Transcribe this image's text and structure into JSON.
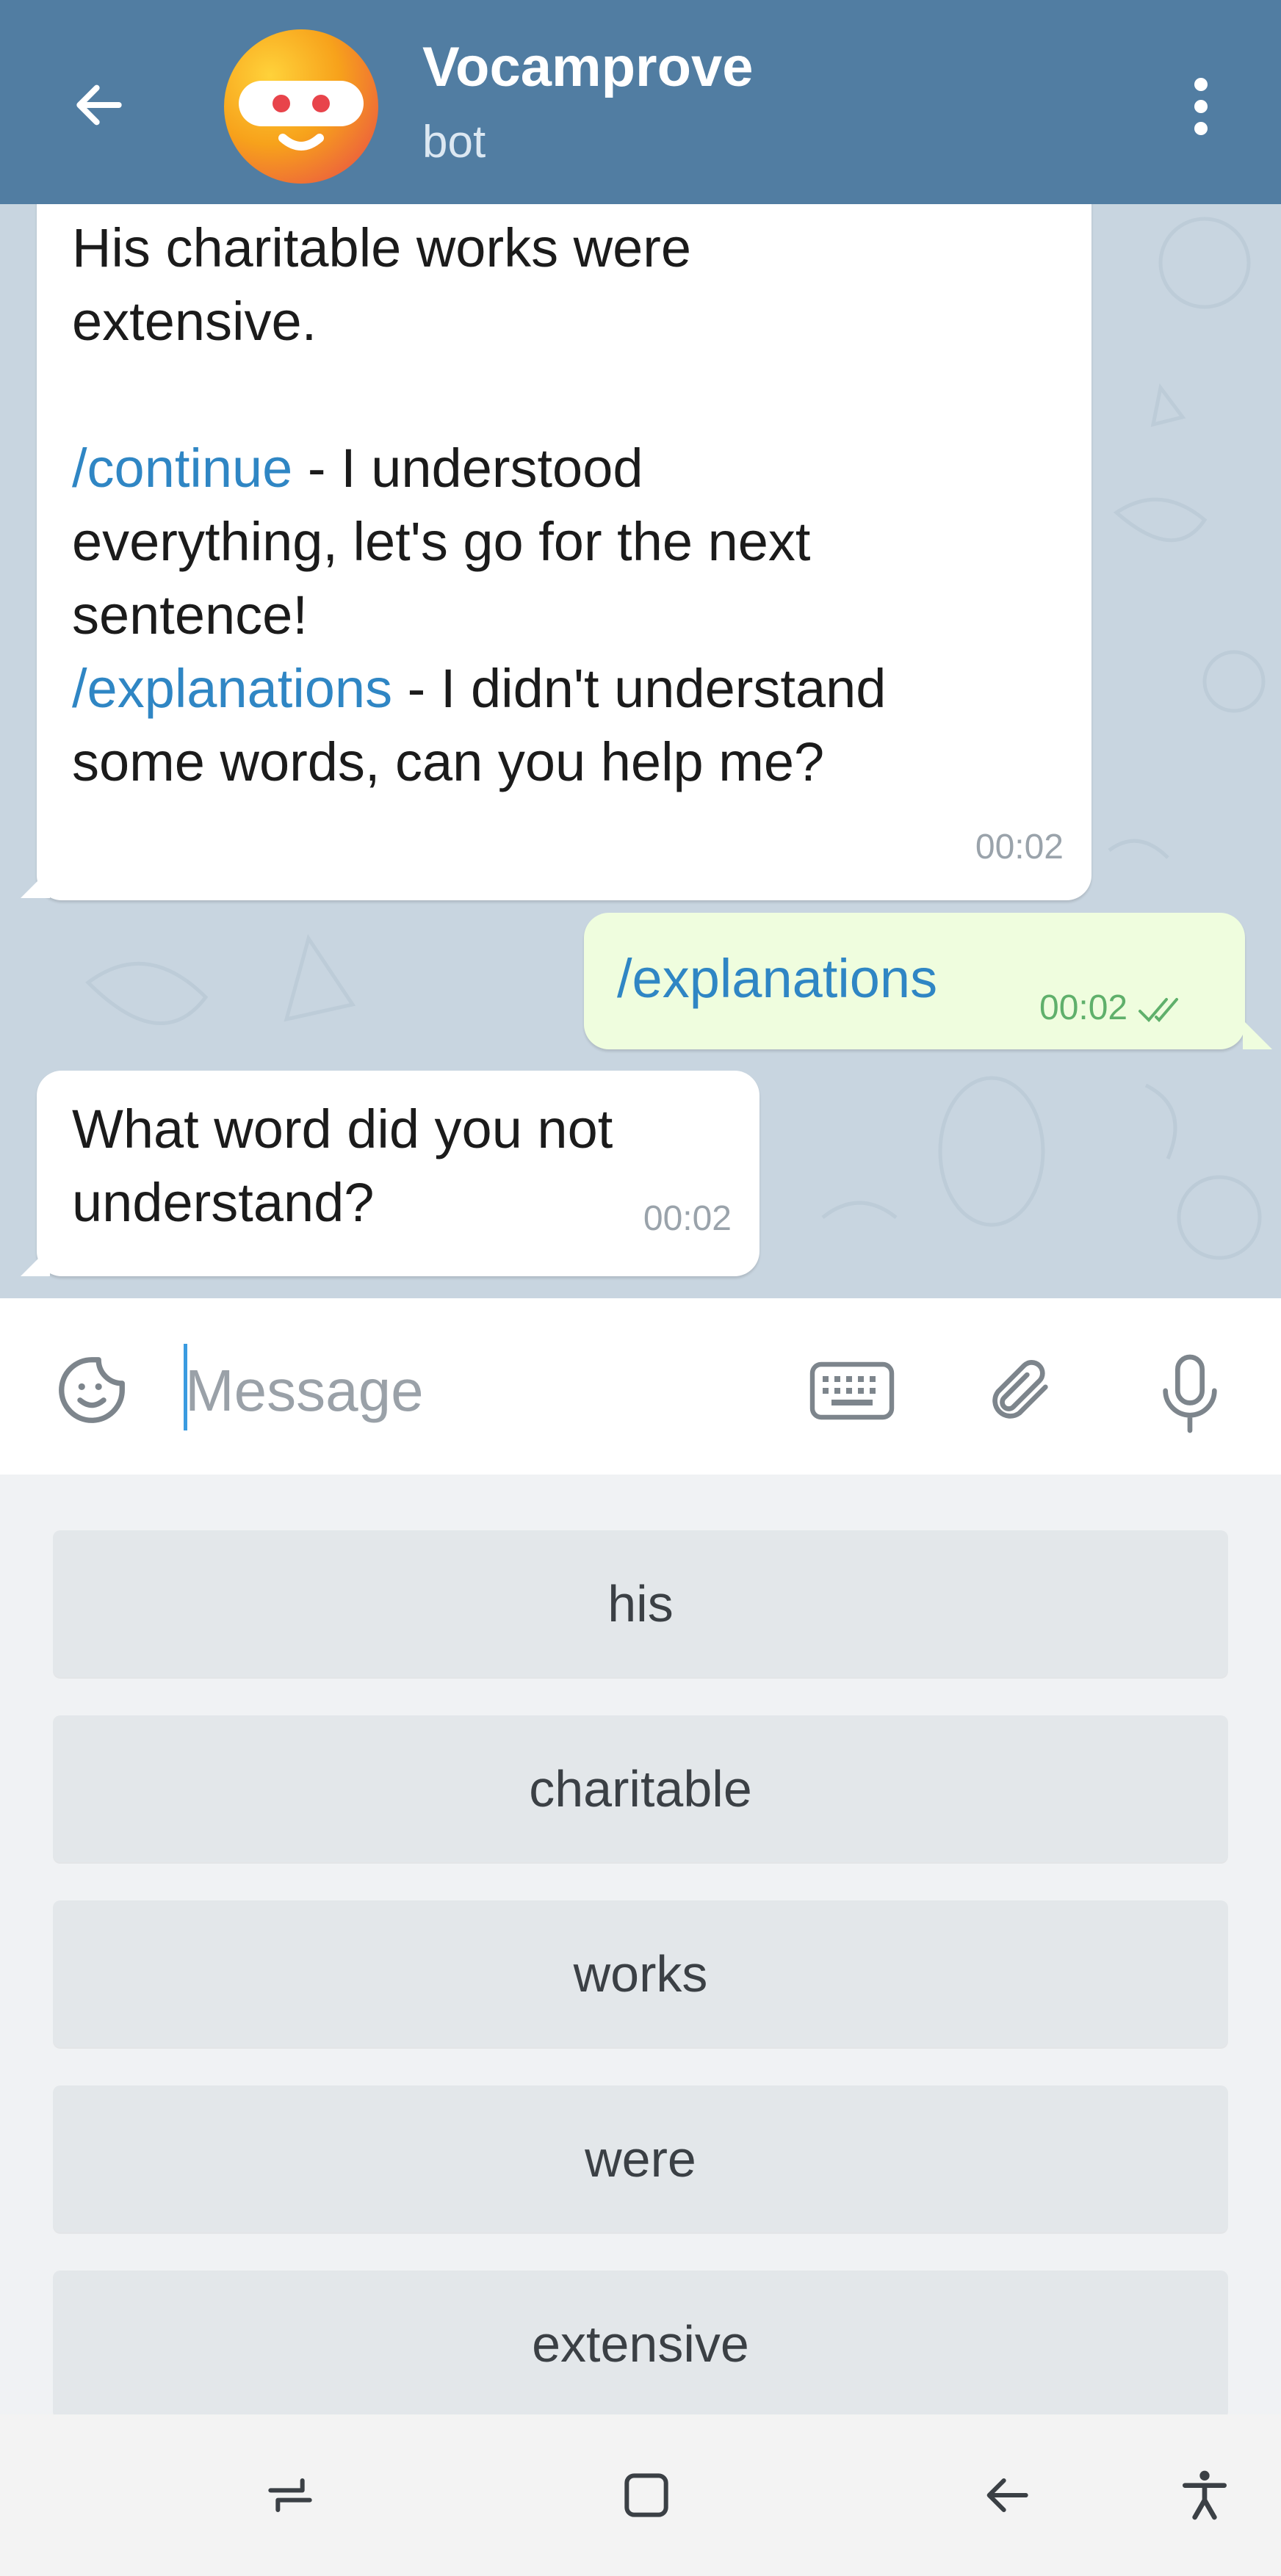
{
  "header": {
    "title": "Vocamprove",
    "subtitle": "bot",
    "back_icon": "arrow-left-icon",
    "menu_icon": "more-vertical-icon",
    "bg_color": "#517da2"
  },
  "messages": [
    {
      "from": "bot",
      "text_line1": "His charitable works were",
      "text_line2": "extensive.",
      "cmd1": "/continue",
      "cmd1_desc_a": " - I understood",
      "cmd1_desc_b": "everything, let's go for the next",
      "cmd1_desc_c": "sentence!",
      "cmd2": "/explanations",
      "cmd2_desc_a": " - I didn't understand",
      "cmd2_desc_b": "some words, can you help me?",
      "time": "00:02"
    },
    {
      "from": "user",
      "text": "/explanations",
      "time": "00:02",
      "status_icon": "double-check-icon"
    },
    {
      "from": "bot",
      "text_line1": "What word did you not",
      "text_line2": "understand?",
      "time": "00:02"
    }
  ],
  "input": {
    "placeholder": "Message",
    "value": "",
    "emoji_icon": "sticker-emoji-icon",
    "keyboard_icon": "keyboard-icon",
    "attach_icon": "paperclip-icon",
    "mic_icon": "microphone-icon"
  },
  "reply_keyboard": [
    "his",
    "charitable",
    "works",
    "were",
    "extensive"
  ],
  "system_nav": {
    "recents_icon": "recent-apps-icon",
    "home_icon": "home-icon",
    "back_icon": "system-back-icon",
    "accessibility_icon": "accessibility-icon"
  },
  "colors": {
    "link": "#2f86c4",
    "outgoing_bubble": "#effdde",
    "read_check": "#5fb06b"
  }
}
